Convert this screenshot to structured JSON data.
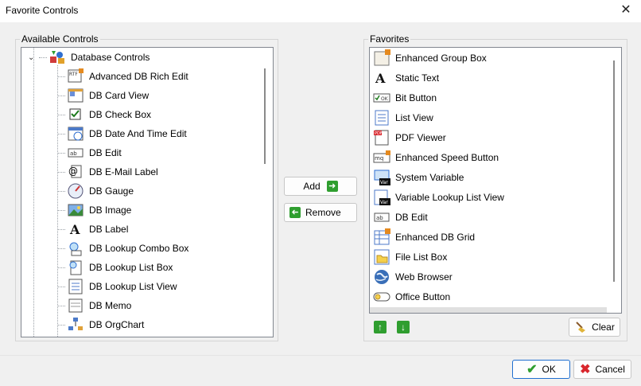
{
  "window": {
    "title": "Favorite Controls",
    "close_glyph": "✕"
  },
  "available": {
    "label": "Available Controls",
    "root": {
      "label": "Database Controls",
      "icon": "database-controls-icon"
    },
    "items": [
      {
        "label": "Advanced DB Rich Edit",
        "icon": "rich-edit-icon"
      },
      {
        "label": "DB Card View",
        "icon": "card-view-icon"
      },
      {
        "label": "DB Check Box",
        "icon": "check-box-icon"
      },
      {
        "label": "DB Date And Time Edit",
        "icon": "calendar-icon"
      },
      {
        "label": "DB Edit",
        "icon": "edit-icon"
      },
      {
        "label": "DB E-Mail Label",
        "icon": "email-label-icon"
      },
      {
        "label": "DB Gauge",
        "icon": "gauge-icon"
      },
      {
        "label": "DB Image",
        "icon": "image-icon"
      },
      {
        "label": "DB Label",
        "icon": "label-icon"
      },
      {
        "label": "DB Lookup Combo Box",
        "icon": "lookup-combo-icon"
      },
      {
        "label": "DB Lookup List Box",
        "icon": "lookup-list-icon"
      },
      {
        "label": "DB Lookup List View",
        "icon": "lookup-list-view-icon"
      },
      {
        "label": "DB Memo",
        "icon": "memo-icon"
      },
      {
        "label": "DB OrgChart",
        "icon": "orgchart-icon"
      }
    ]
  },
  "actions": {
    "add_label": "Add",
    "remove_label": "Remove"
  },
  "favorites": {
    "label": "Favorites",
    "items": [
      {
        "label": "Enhanced Group Box",
        "icon": "group-box-icon"
      },
      {
        "label": "Static Text",
        "icon": "static-text-icon"
      },
      {
        "label": "Bit Button",
        "icon": "bit-button-icon"
      },
      {
        "label": "List View",
        "icon": "list-view-icon"
      },
      {
        "label": "PDF Viewer",
        "icon": "pdf-icon"
      },
      {
        "label": "Enhanced Speed Button",
        "icon": "speed-button-icon"
      },
      {
        "label": "System Variable",
        "icon": "system-variable-icon"
      },
      {
        "label": "Variable Lookup List View",
        "icon": "variable-lookup-icon"
      },
      {
        "label": "DB Edit",
        "icon": "edit-icon"
      },
      {
        "label": "Enhanced DB Grid",
        "icon": "db-grid-icon"
      },
      {
        "label": "File List Box",
        "icon": "file-list-icon"
      },
      {
        "label": "Web Browser",
        "icon": "globe-icon"
      },
      {
        "label": "Office Button",
        "icon": "office-button-icon"
      }
    ],
    "clear_label": "Clear"
  },
  "footer": {
    "ok_label": "OK",
    "cancel_label": "Cancel"
  },
  "colors": {
    "accent_green": "#2f9e2f",
    "cancel_red": "#d9262c",
    "default_border": "#1f6fd0"
  }
}
